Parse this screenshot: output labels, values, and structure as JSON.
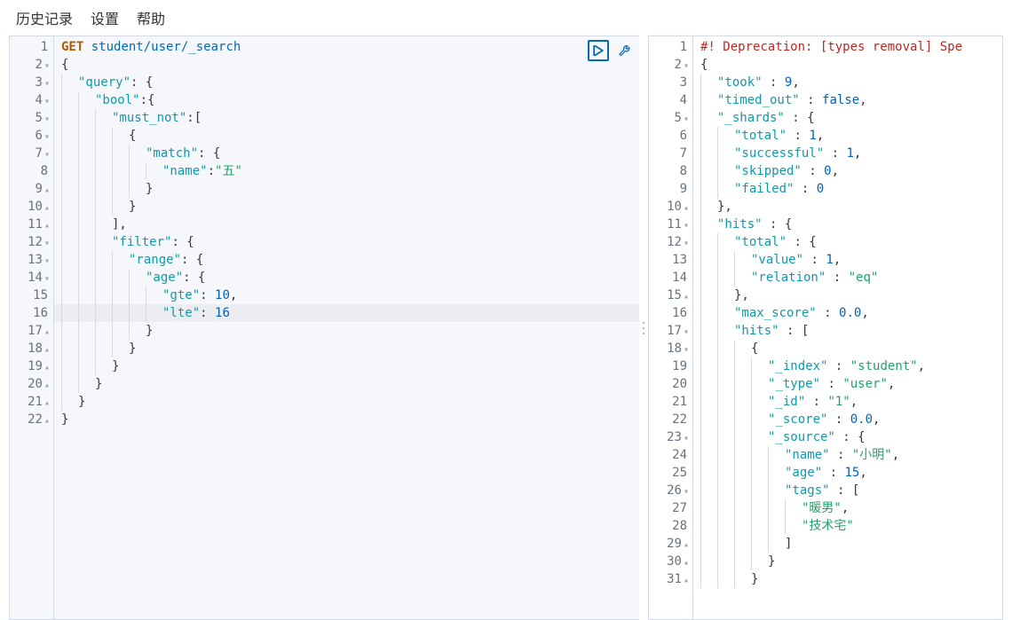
{
  "toolbar": {
    "history": "历史记录",
    "settings": "设置",
    "help": "帮助"
  },
  "editor": {
    "method": "GET",
    "endpoint": "student/user/_search",
    "lines": [
      {
        "n": 1,
        "marker": "",
        "indent": 0,
        "tokens": [
          {
            "t": "method",
            "v": "GET"
          },
          {
            "t": "space",
            "v": " "
          },
          {
            "t": "endpoint",
            "v": "student/user/_search"
          }
        ]
      },
      {
        "n": 2,
        "marker": "▾",
        "indent": 0,
        "tokens": [
          {
            "t": "pun",
            "v": "{"
          }
        ]
      },
      {
        "n": 3,
        "marker": "▾",
        "indent": 1,
        "tokens": [
          {
            "t": "key",
            "v": "\"query\""
          },
          {
            "t": "pun",
            "v": ": {"
          }
        ]
      },
      {
        "n": 4,
        "marker": "▾",
        "indent": 2,
        "tokens": [
          {
            "t": "key",
            "v": "\"bool\""
          },
          {
            "t": "pun",
            "v": ":{"
          }
        ]
      },
      {
        "n": 5,
        "marker": "▾",
        "indent": 3,
        "tokens": [
          {
            "t": "key",
            "v": "\"must_not\""
          },
          {
            "t": "pun",
            "v": ":["
          }
        ]
      },
      {
        "n": 6,
        "marker": "▾",
        "indent": 4,
        "tokens": [
          {
            "t": "pun",
            "v": "{"
          }
        ]
      },
      {
        "n": 7,
        "marker": "▾",
        "indent": 5,
        "tokens": [
          {
            "t": "key",
            "v": "\"match\""
          },
          {
            "t": "pun",
            "v": ": {"
          }
        ]
      },
      {
        "n": 8,
        "marker": "",
        "indent": 6,
        "tokens": [
          {
            "t": "key",
            "v": "\"name\""
          },
          {
            "t": "pun",
            "v": ":"
          },
          {
            "t": "str",
            "v": "\"五\""
          }
        ]
      },
      {
        "n": 9,
        "marker": "▴",
        "indent": 5,
        "tokens": [
          {
            "t": "pun",
            "v": "}"
          }
        ]
      },
      {
        "n": 10,
        "marker": "▴",
        "indent": 4,
        "tokens": [
          {
            "t": "pun",
            "v": "}"
          }
        ]
      },
      {
        "n": 11,
        "marker": "▴",
        "indent": 3,
        "tokens": [
          {
            "t": "pun",
            "v": "],"
          }
        ]
      },
      {
        "n": 12,
        "marker": "▾",
        "indent": 3,
        "tokens": [
          {
            "t": "key",
            "v": "\"filter\""
          },
          {
            "t": "pun",
            "v": ": {"
          }
        ]
      },
      {
        "n": 13,
        "marker": "▾",
        "indent": 4,
        "tokens": [
          {
            "t": "key",
            "v": "\"range\""
          },
          {
            "t": "pun",
            "v": ": {"
          }
        ]
      },
      {
        "n": 14,
        "marker": "▾",
        "indent": 5,
        "tokens": [
          {
            "t": "key",
            "v": "\"age\""
          },
          {
            "t": "pun",
            "v": ": {"
          }
        ]
      },
      {
        "n": 15,
        "marker": "",
        "indent": 6,
        "tokens": [
          {
            "t": "key",
            "v": "\"gte\""
          },
          {
            "t": "pun",
            "v": ": "
          },
          {
            "t": "num",
            "v": "10"
          },
          {
            "t": "pun",
            "v": ","
          }
        ]
      },
      {
        "n": 16,
        "marker": "",
        "indent": 6,
        "tokens": [
          {
            "t": "key",
            "v": "\"lte\""
          },
          {
            "t": "pun",
            "v": ": "
          },
          {
            "t": "num",
            "v": "16"
          }
        ]
      },
      {
        "n": 17,
        "marker": "▴",
        "indent": 5,
        "tokens": [
          {
            "t": "pun",
            "v": "}"
          }
        ]
      },
      {
        "n": 18,
        "marker": "▴",
        "indent": 4,
        "tokens": [
          {
            "t": "pun",
            "v": "}"
          }
        ]
      },
      {
        "n": 19,
        "marker": "▴",
        "indent": 3,
        "tokens": [
          {
            "t": "pun",
            "v": "}"
          }
        ]
      },
      {
        "n": 20,
        "marker": "▴",
        "indent": 2,
        "tokens": [
          {
            "t": "pun",
            "v": "}"
          }
        ]
      },
      {
        "n": 21,
        "marker": "▴",
        "indent": 1,
        "tokens": [
          {
            "t": "pun",
            "v": "}"
          }
        ]
      },
      {
        "n": 22,
        "marker": "▴",
        "indent": 0,
        "tokens": [
          {
            "t": "pun",
            "v": "}"
          }
        ]
      }
    ],
    "cursor_line": 16
  },
  "result": {
    "lines": [
      {
        "n": 1,
        "marker": "",
        "indent": 0,
        "tokens": [
          {
            "t": "warn",
            "v": "#! Deprecation: [types removal] Spe"
          }
        ]
      },
      {
        "n": 2,
        "marker": "▾",
        "indent": 0,
        "tokens": [
          {
            "t": "pun",
            "v": "{"
          }
        ]
      },
      {
        "n": 3,
        "marker": "",
        "indent": 1,
        "tokens": [
          {
            "t": "key",
            "v": "\"took\""
          },
          {
            "t": "pun",
            "v": " : "
          },
          {
            "t": "num",
            "v": "9"
          },
          {
            "t": "pun",
            "v": ","
          }
        ]
      },
      {
        "n": 4,
        "marker": "",
        "indent": 1,
        "tokens": [
          {
            "t": "key",
            "v": "\"timed_out\""
          },
          {
            "t": "pun",
            "v": " : "
          },
          {
            "t": "bool",
            "v": "false"
          },
          {
            "t": "pun",
            "v": ","
          }
        ]
      },
      {
        "n": 5,
        "marker": "▾",
        "indent": 1,
        "tokens": [
          {
            "t": "key",
            "v": "\"_shards\""
          },
          {
            "t": "pun",
            "v": " : {"
          }
        ]
      },
      {
        "n": 6,
        "marker": "",
        "indent": 2,
        "tokens": [
          {
            "t": "key",
            "v": "\"total\""
          },
          {
            "t": "pun",
            "v": " : "
          },
          {
            "t": "num",
            "v": "1"
          },
          {
            "t": "pun",
            "v": ","
          }
        ]
      },
      {
        "n": 7,
        "marker": "",
        "indent": 2,
        "tokens": [
          {
            "t": "key",
            "v": "\"successful\""
          },
          {
            "t": "pun",
            "v": " : "
          },
          {
            "t": "num",
            "v": "1"
          },
          {
            "t": "pun",
            "v": ","
          }
        ]
      },
      {
        "n": 8,
        "marker": "",
        "indent": 2,
        "tokens": [
          {
            "t": "key",
            "v": "\"skipped\""
          },
          {
            "t": "pun",
            "v": " : "
          },
          {
            "t": "num",
            "v": "0"
          },
          {
            "t": "pun",
            "v": ","
          }
        ]
      },
      {
        "n": 9,
        "marker": "",
        "indent": 2,
        "tokens": [
          {
            "t": "key",
            "v": "\"failed\""
          },
          {
            "t": "pun",
            "v": " : "
          },
          {
            "t": "num",
            "v": "0"
          }
        ]
      },
      {
        "n": 10,
        "marker": "▴",
        "indent": 1,
        "tokens": [
          {
            "t": "pun",
            "v": "},"
          }
        ]
      },
      {
        "n": 11,
        "marker": "▾",
        "indent": 1,
        "tokens": [
          {
            "t": "key",
            "v": "\"hits\""
          },
          {
            "t": "pun",
            "v": " : {"
          }
        ]
      },
      {
        "n": 12,
        "marker": "▾",
        "indent": 2,
        "tokens": [
          {
            "t": "key",
            "v": "\"total\""
          },
          {
            "t": "pun",
            "v": " : {"
          }
        ]
      },
      {
        "n": 13,
        "marker": "",
        "indent": 3,
        "tokens": [
          {
            "t": "key",
            "v": "\"value\""
          },
          {
            "t": "pun",
            "v": " : "
          },
          {
            "t": "num",
            "v": "1"
          },
          {
            "t": "pun",
            "v": ","
          }
        ]
      },
      {
        "n": 14,
        "marker": "",
        "indent": 3,
        "tokens": [
          {
            "t": "key",
            "v": "\"relation\""
          },
          {
            "t": "pun",
            "v": " : "
          },
          {
            "t": "str",
            "v": "\"eq\""
          }
        ]
      },
      {
        "n": 15,
        "marker": "▴",
        "indent": 2,
        "tokens": [
          {
            "t": "pun",
            "v": "},"
          }
        ]
      },
      {
        "n": 16,
        "marker": "",
        "indent": 2,
        "tokens": [
          {
            "t": "key",
            "v": "\"max_score\""
          },
          {
            "t": "pun",
            "v": " : "
          },
          {
            "t": "num",
            "v": "0.0"
          },
          {
            "t": "pun",
            "v": ","
          }
        ]
      },
      {
        "n": 17,
        "marker": "▾",
        "indent": 2,
        "tokens": [
          {
            "t": "key",
            "v": "\"hits\""
          },
          {
            "t": "pun",
            "v": " : ["
          }
        ]
      },
      {
        "n": 18,
        "marker": "▾",
        "indent": 3,
        "tokens": [
          {
            "t": "pun",
            "v": "{"
          }
        ]
      },
      {
        "n": 19,
        "marker": "",
        "indent": 4,
        "tokens": [
          {
            "t": "key",
            "v": "\"_index\""
          },
          {
            "t": "pun",
            "v": " : "
          },
          {
            "t": "str",
            "v": "\"student\""
          },
          {
            "t": "pun",
            "v": ","
          }
        ]
      },
      {
        "n": 20,
        "marker": "",
        "indent": 4,
        "tokens": [
          {
            "t": "key",
            "v": "\"_type\""
          },
          {
            "t": "pun",
            "v": " : "
          },
          {
            "t": "str",
            "v": "\"user\""
          },
          {
            "t": "pun",
            "v": ","
          }
        ]
      },
      {
        "n": 21,
        "marker": "",
        "indent": 4,
        "tokens": [
          {
            "t": "key",
            "v": "\"_id\""
          },
          {
            "t": "pun",
            "v": " : "
          },
          {
            "t": "str",
            "v": "\"1\""
          },
          {
            "t": "pun",
            "v": ","
          }
        ]
      },
      {
        "n": 22,
        "marker": "",
        "indent": 4,
        "tokens": [
          {
            "t": "key",
            "v": "\"_score\""
          },
          {
            "t": "pun",
            "v": " : "
          },
          {
            "t": "num",
            "v": "0.0"
          },
          {
            "t": "pun",
            "v": ","
          }
        ]
      },
      {
        "n": 23,
        "marker": "▾",
        "indent": 4,
        "tokens": [
          {
            "t": "key",
            "v": "\"_source\""
          },
          {
            "t": "pun",
            "v": " : {"
          }
        ]
      },
      {
        "n": 24,
        "marker": "",
        "indent": 5,
        "tokens": [
          {
            "t": "key",
            "v": "\"name\""
          },
          {
            "t": "pun",
            "v": " : "
          },
          {
            "t": "str",
            "v": "\"小明\""
          },
          {
            "t": "pun",
            "v": ","
          }
        ]
      },
      {
        "n": 25,
        "marker": "",
        "indent": 5,
        "tokens": [
          {
            "t": "key",
            "v": "\"age\""
          },
          {
            "t": "pun",
            "v": " : "
          },
          {
            "t": "num",
            "v": "15"
          },
          {
            "t": "pun",
            "v": ","
          }
        ]
      },
      {
        "n": 26,
        "marker": "▾",
        "indent": 5,
        "tokens": [
          {
            "t": "key",
            "v": "\"tags\""
          },
          {
            "t": "pun",
            "v": " : ["
          }
        ]
      },
      {
        "n": 27,
        "marker": "",
        "indent": 6,
        "tokens": [
          {
            "t": "str",
            "v": "\"暖男\""
          },
          {
            "t": "pun",
            "v": ","
          }
        ]
      },
      {
        "n": 28,
        "marker": "",
        "indent": 6,
        "tokens": [
          {
            "t": "str",
            "v": "\"技术宅\""
          }
        ]
      },
      {
        "n": 29,
        "marker": "▴",
        "indent": 5,
        "tokens": [
          {
            "t": "pun",
            "v": "]"
          }
        ]
      },
      {
        "n": 30,
        "marker": "▴",
        "indent": 4,
        "tokens": [
          {
            "t": "pun",
            "v": "}"
          }
        ]
      },
      {
        "n": 31,
        "marker": "▴",
        "indent": 3,
        "tokens": [
          {
            "t": "pun",
            "v": "}"
          }
        ]
      }
    ]
  }
}
